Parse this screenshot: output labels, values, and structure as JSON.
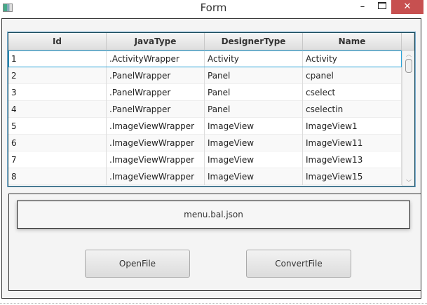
{
  "window": {
    "title": "Form",
    "minimize": "–",
    "close": "✕"
  },
  "table": {
    "columns": [
      "Id",
      "JavaType",
      "DesignerType",
      "Name"
    ],
    "rows": [
      [
        "1",
        ".ActivityWrapper",
        "Activity",
        "Activity"
      ],
      [
        "2",
        ".PanelWrapper",
        "Panel",
        "cpanel"
      ],
      [
        "3",
        ".PanelWrapper",
        "Panel",
        "cselect"
      ],
      [
        "4",
        ".PanelWrapper",
        "Panel",
        "cselectin"
      ],
      [
        "5",
        ".ImageViewWrapper",
        "ImageView",
        "ImageView1"
      ],
      [
        "6",
        ".ImageViewWrapper",
        "ImageView",
        "ImageView11"
      ],
      [
        "7",
        ".ImageViewWrapper",
        "ImageView",
        "ImageView13"
      ],
      [
        "8",
        ".ImageViewWrapper",
        "ImageView",
        "ImageView15"
      ]
    ],
    "selected_row": 0
  },
  "file_label": "menu.bal.json",
  "buttons": {
    "open": "OpenFile",
    "convert": "ConvertFile"
  }
}
